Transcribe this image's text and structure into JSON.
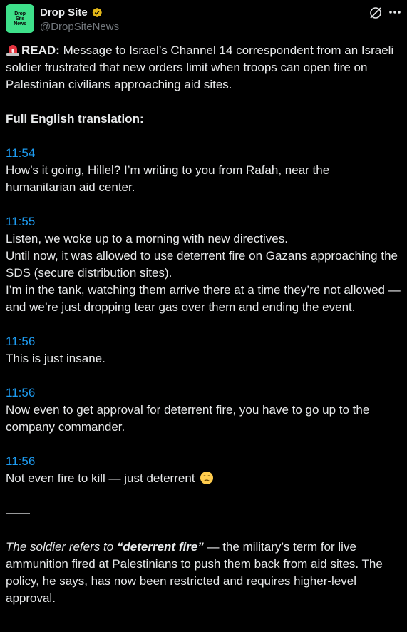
{
  "author": {
    "avatar_text": "Drop\nSite\nNews",
    "display_name": "Drop Site",
    "handle": "@DropSiteNews"
  },
  "icons": {
    "verified": "verified-badge-gold",
    "grok": "grok-icon",
    "more": "more-icon",
    "alert": "rotating-light-emoji",
    "emoji_crying": "crying-face-emoji"
  },
  "colors": {
    "background": "#000000",
    "text": "#e7e9ea",
    "muted": "#71767b",
    "link_blue": "#1d9bf0",
    "avatar_green": "#3ee08a",
    "verified_gold": "#e2b719"
  },
  "intro": {
    "label": "READ:",
    "text": " Message to Israel’s Channel 14 correspondent from an Israeli soldier frustrated that new orders limit when troops can open fire on Palestinian civilians approaching aid sites."
  },
  "translation_heading": "Full English translation:",
  "messages": [
    {
      "time": "11:54",
      "lines": [
        "How’s it going, Hillel? I’m writing to you from Rafah, near the humanitarian aid center."
      ]
    },
    {
      "time": "11:55",
      "lines": [
        "Listen, we woke up to a morning with new directives.",
        "Until now, it was allowed to use deterrent fire on Gazans approaching the SDS (secure distribution sites).",
        "I’m in the tank, watching them arrive there at a time they’re not allowed —",
        "and we’re just dropping tear gas over them and ending the event."
      ]
    },
    {
      "time": "11:56",
      "lines": [
        "This is just insane."
      ]
    },
    {
      "time": "11:56",
      "lines": [
        "Now even to get approval for deterrent fire, you have to go up to the company commander."
      ]
    },
    {
      "time": "11:56",
      "lines": [
        "Not even fire to kill — just deterrent"
      ]
    }
  ],
  "divider": "——",
  "closing": {
    "italic_lead": "The soldier refers to ",
    "bold_term": "“deterrent fire”",
    "rest": " — the military’s term for live ammunition fired at Palestinians to push them back from aid sites. The policy, he says, has now been restricted and requires higher-level approval."
  }
}
